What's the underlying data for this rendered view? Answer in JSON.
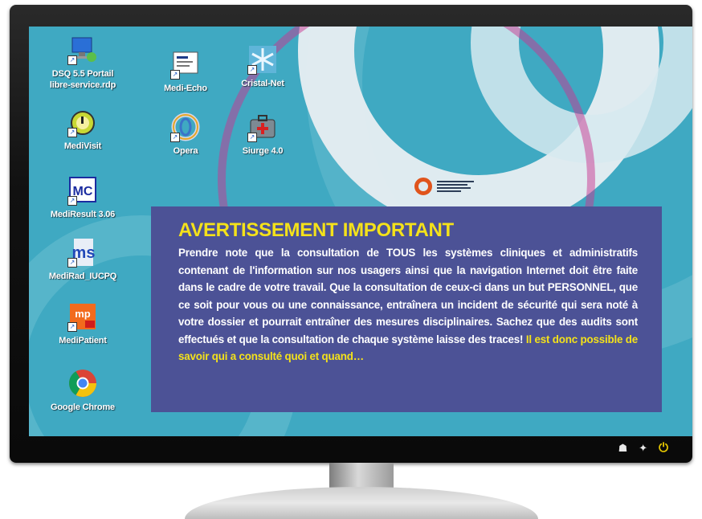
{
  "desktop": {
    "icons": [
      {
        "label": "DSQ 5.5 Portail\nlibre-service.rdp",
        "icon": "remote-desktop-icon"
      },
      {
        "label": "Medi-Echo",
        "icon": "medi-echo-icon"
      },
      {
        "label": "Cristal-Net",
        "icon": "cristal-net-icon"
      },
      {
        "label": "MediVisit",
        "icon": "medivisit-icon"
      },
      {
        "label": "Opera",
        "icon": "opera-icon"
      },
      {
        "label": "Siurge 4.0",
        "icon": "siurge-icon"
      },
      {
        "label": "MediResult 3.06",
        "icon": "mediresult-icon"
      },
      {
        "label": "MediRad_IUCPQ",
        "icon": "medirad-icon"
      },
      {
        "label": "MediPatient",
        "icon": "medipatient-icon"
      },
      {
        "label": "Google Chrome",
        "icon": "chrome-icon"
      }
    ],
    "icon_text": {
      "mediresult": "MC",
      "medipatient": "mp",
      "medirad": "ms"
    }
  },
  "warning": {
    "title": "AVERTISSEMENT IMPORTANT",
    "body": "Prendre note que la consultation de TOUS les systèmes cliniques et administratifs contenant de l'information sur nos usagers ainsi que la navigation Internet doit être faite dans le cadre de votre travail. Que la consultation de ceux-ci dans un but PERSONNEL, que ce soit pour vous ou une connaissance, entraînera un incident de sécurité qui sera noté à votre dossier et pourrait entraîner des mesures disciplinaires. Sachez que des audits sont effectués et que la consultation de chaque système laisse des traces!",
    "highlight": " Il est donc possible de savoir qui a consulté quoi et quand…"
  },
  "tray": {
    "icons": [
      "network-icon",
      "network-icon",
      "power-icon"
    ]
  },
  "colors": {
    "desktop_bg": "#3fa9c2",
    "panel_bg": "#4c5296",
    "title_color": "#f4e21a",
    "logo_ring": "#e0541c"
  }
}
